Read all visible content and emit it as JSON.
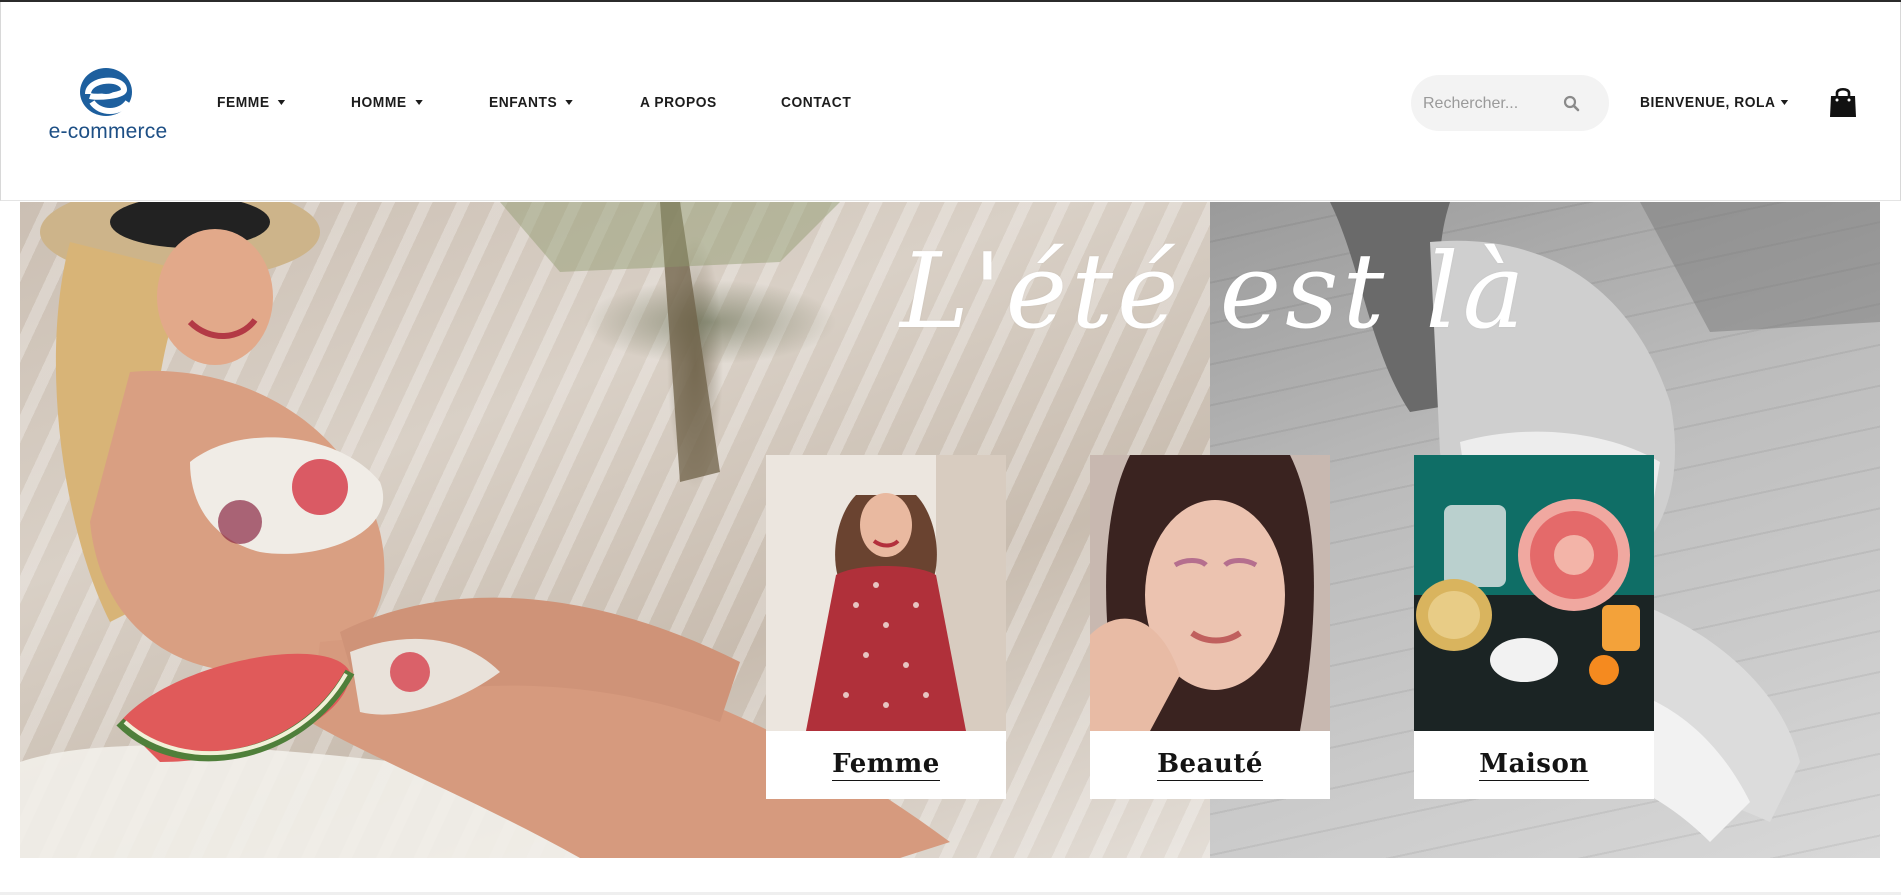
{
  "brand": {
    "logo_text": "e-commerce",
    "logo_color": "#1d4f85"
  },
  "nav": {
    "items": [
      {
        "label": "FEMME",
        "has_dropdown": true
      },
      {
        "label": "HOMME",
        "has_dropdown": true
      },
      {
        "label": "ENFANTS",
        "has_dropdown": true
      },
      {
        "label": "A PROPOS",
        "has_dropdown": false
      },
      {
        "label": "CONTACT",
        "has_dropdown": false
      }
    ]
  },
  "search": {
    "placeholder": "Rechercher...",
    "value": "",
    "icon": "search-icon"
  },
  "account": {
    "welcome_label": "BIENVENUE, ROLA",
    "cart_icon": "shopping-bag-icon"
  },
  "hero": {
    "title": "L'été est là"
  },
  "categories": [
    {
      "label": "Femme",
      "photo_accent": "#b0303a"
    },
    {
      "label": "Beauté",
      "photo_accent": "#d9a08c"
    },
    {
      "label": "Maison",
      "photo_accent": "#0f6e66"
    }
  ]
}
